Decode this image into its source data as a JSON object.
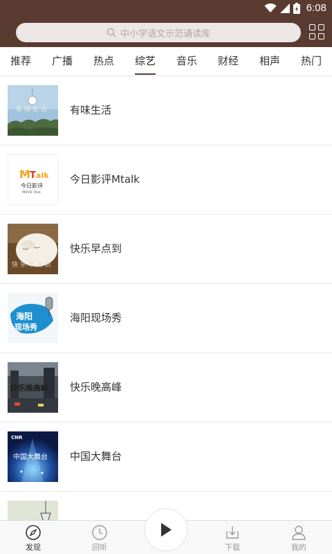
{
  "status_bar": {
    "time": "6:08"
  },
  "search": {
    "placeholder": "中小学语文示范诵读库"
  },
  "tabs": [
    {
      "label": "推荐"
    },
    {
      "label": "广播"
    },
    {
      "label": "热点"
    },
    {
      "label": "综艺",
      "active": true
    },
    {
      "label": "音乐"
    },
    {
      "label": "财经"
    },
    {
      "label": "相声"
    },
    {
      "label": "热门"
    }
  ],
  "list": [
    {
      "title": "有味生活"
    },
    {
      "title": "今日影评Mtalk",
      "thumb_text": "今日影评",
      "thumb_logo": "MTalk",
      "thumb_sub": "MOVIE TALK"
    },
    {
      "title": "快乐早点到"
    },
    {
      "title": "海阳现场秀",
      "thumb_text": "海阳 现场秀"
    },
    {
      "title": "快乐晚高峰",
      "thumb_text": "快乐晚高峰"
    },
    {
      "title": "中国大舞台",
      "thumb_logo": "CNR"
    },
    {
      "title": ""
    }
  ],
  "bottom_nav": [
    {
      "label": "发现",
      "icon": "compass-icon",
      "active": true
    },
    {
      "label": "回听",
      "icon": "clock-icon"
    },
    {
      "label": "下载",
      "icon": "download-icon"
    },
    {
      "label": "我的",
      "icon": "user-icon"
    }
  ],
  "colors": {
    "header": "#5a3b32",
    "accent": "#5a3b32"
  }
}
